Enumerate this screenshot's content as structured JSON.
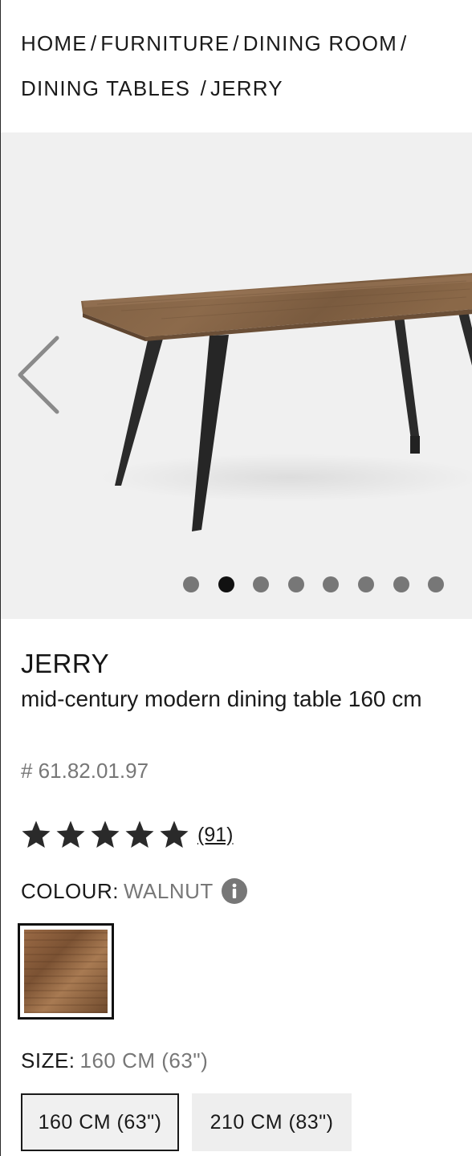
{
  "breadcrumb": {
    "home": "HOME",
    "furniture": "FURNITURE",
    "dining_room": "DINING ROOM",
    "dining_tables": "DINING TABLES",
    "current": "JERRY",
    "separator": "/"
  },
  "gallery": {
    "slide_count": 8,
    "active_slide": 2,
    "prev_icon": "chevron-left-icon"
  },
  "product": {
    "name": "JERRY",
    "description": "mid-century modern dining table 160 cm",
    "sku": "# 61.82.01.97",
    "rating": {
      "stars": 5,
      "max_stars": 5,
      "review_count": "(91)"
    },
    "colour": {
      "label": "COLOUR:",
      "value": "WALNUT",
      "info_icon": "info-icon",
      "swatch_color": "#8a5e3c"
    },
    "size": {
      "label": "SIZE:",
      "value": "160 CM (63\")",
      "options": [
        {
          "label": "160 CM (63\")",
          "selected": true
        },
        {
          "label": "210 CM (83\")",
          "selected": false
        }
      ]
    }
  },
  "colors": {
    "text": "#1a1a1a",
    "muted": "#777777",
    "gallery_bg": "#f0f0f0",
    "dot_active": "#111111",
    "dot_inactive": "#777777"
  }
}
